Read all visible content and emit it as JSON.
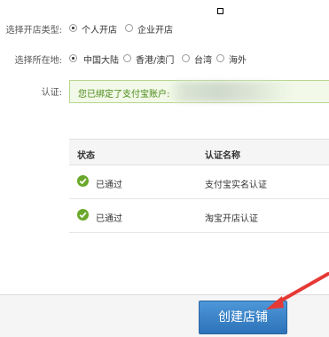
{
  "shop_type": {
    "label": "选择开店类型:",
    "options": [
      {
        "label": "个人开店",
        "selected": true
      },
      {
        "label": "企业开店",
        "selected": false
      }
    ]
  },
  "location": {
    "label": "选择所在地:",
    "options": [
      {
        "label": "中国大陆",
        "selected": true
      },
      {
        "label": "香港/澳门",
        "selected": false
      },
      {
        "label": "台湾",
        "selected": false
      },
      {
        "label": "海外",
        "selected": false
      }
    ]
  },
  "auth": {
    "label": "认证:",
    "message": "您已绑定了支付宝账户:"
  },
  "table": {
    "headers": [
      "状态",
      "认证名称"
    ],
    "rows": [
      {
        "status": "已通过",
        "name": "支付宝实名认证"
      },
      {
        "status": "已通过",
        "name": "淘宝开店认证"
      }
    ]
  },
  "footer": {
    "create_button": "创建店铺"
  },
  "colors": {
    "accent_green": "#4b8a18",
    "check_green": "#6aa82a",
    "button_blue": "#2d73b9",
    "arrow_red": "#e53935"
  }
}
